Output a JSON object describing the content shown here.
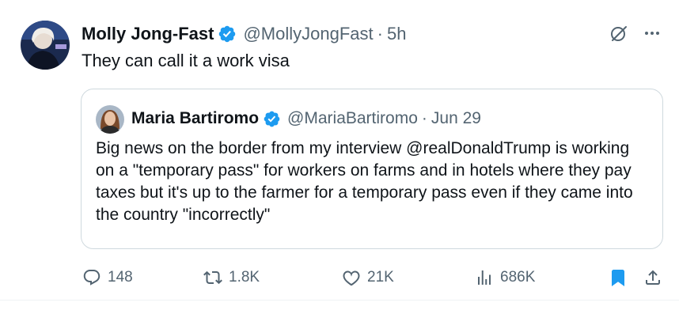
{
  "tweet": {
    "author_name": "Molly Jong-Fast",
    "handle": "@MollyJongFast",
    "separator": "·",
    "time": "5h",
    "text": "They can call it a work visa",
    "avatar_icon": "author-avatar",
    "verified_icon": "verified-badge-icon",
    "top_icons": [
      "grok-icon",
      "more-icon"
    ]
  },
  "quote": {
    "author_name": "Maria Bartiromo",
    "handle": "@MariaBartiromo",
    "separator": "·",
    "date": "Jun 29",
    "text": "Big news on the border from my interview @realDonaldTrump is working on a \"temporary pass\" for workers on farms and in hotels where they pay taxes but it's up to the farmer for a temporary pass even if they came into the country \"incorrectly\""
  },
  "actions": {
    "replies": "148",
    "reposts": "1.8K",
    "likes": "21K",
    "views": "686K",
    "icons": [
      "reply-icon",
      "repost-icon",
      "like-icon",
      "views-icon",
      "bookmark-icon",
      "share-icon"
    ]
  },
  "colors": {
    "text": "#0f1419",
    "secondary": "#536471",
    "verified": "#1d9bf0",
    "bookmark_active": "#1d9bf0",
    "border": "#cfd9de"
  }
}
